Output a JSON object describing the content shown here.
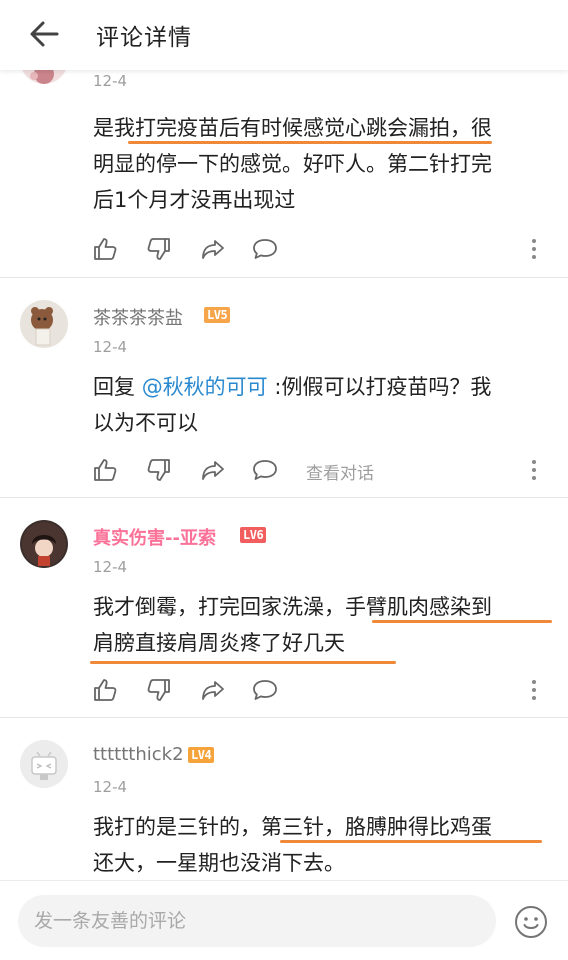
{
  "header": {
    "title": "评论详情"
  },
  "comments": [
    {
      "date": "12-4",
      "content_segments": [
        "是我",
        "打完疫苗后有时候感觉心跳会漏拍",
        "，很明显的停一下的感觉。好吓人。第二针打完后1个月才没再出现过"
      ],
      "line1": "是我打完疫苗后有时候感觉心跳会漏拍，很",
      "line2": "明显的停一下的感觉。好吓人。第二针打完",
      "line3": "后1个月才没再出现过"
    },
    {
      "username": "茶茶茶茶盐",
      "level": "LV5",
      "date": "12-4",
      "reply_prefix": "回复 ",
      "mention": "@秋秋的可可",
      "line1_rest": " :例假可以打疫苗吗？我",
      "line2": "以为不可以",
      "view_conversation": "查看对话"
    },
    {
      "username": "真实伤害--亚索",
      "level": "LV6",
      "date": "12-4",
      "line1": "我才倒霉，打完回家洗澡，手臂肌肉感染到",
      "line2": "肩膀直接肩周炎疼了好几天"
    },
    {
      "username": "tttttthick2",
      "level": "LV4",
      "date": "12-4",
      "line1": "我打的是三针的，第三针，胳膊肿得比鸡蛋",
      "line2": "还大，一星期也没消下去。"
    }
  ],
  "input": {
    "placeholder": "发一条友善的评论"
  },
  "icons": [
    "back-arrow-icon",
    "like-icon",
    "dislike-icon",
    "share-icon",
    "reply-icon",
    "more-icon",
    "emoji-icon"
  ],
  "colors": {
    "accent_pink": "#fb7299",
    "mention_blue": "#2a8ad0",
    "underline_orange": "#f0883a",
    "level_lv5": "#f7a54a",
    "level_lv6": "#f25d5d",
    "level_lv4": "#f5a33a"
  }
}
